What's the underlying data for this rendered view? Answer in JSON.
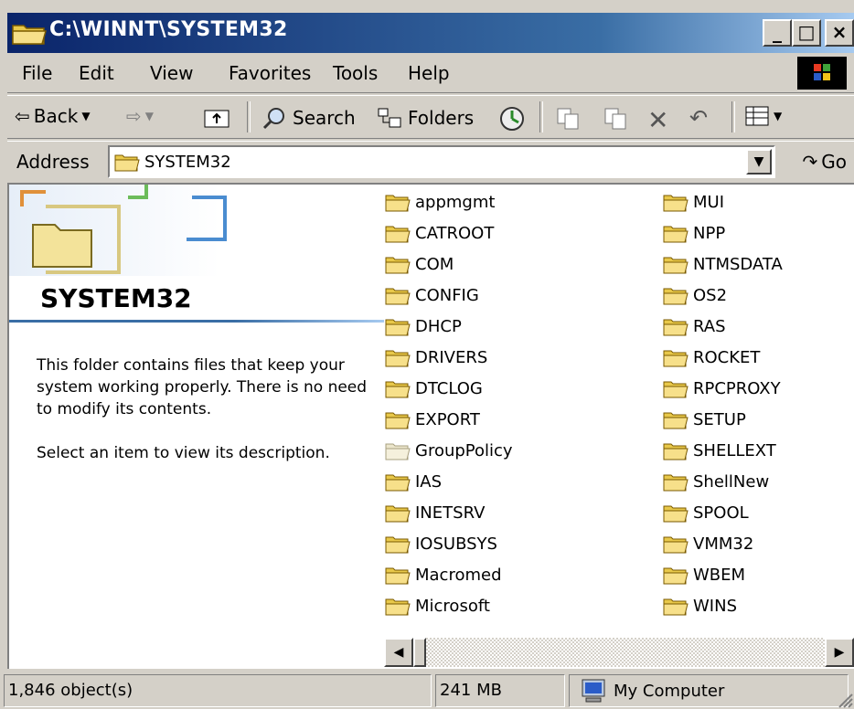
{
  "window": {
    "title": "C:\\WINNT\\SYSTEM32",
    "controls": {
      "minimize": "_",
      "maximize": "□",
      "close": "×"
    }
  },
  "menu": [
    "File",
    "Edit",
    "View",
    "Favorites",
    "Tools",
    "Help"
  ],
  "toolbar": {
    "back_label": "Back",
    "search_label": "Search",
    "folders_label": "Folders"
  },
  "address": {
    "label": "Address",
    "value": "SYSTEM32",
    "go_label": "Go"
  },
  "left_pane": {
    "heading": "SYSTEM32",
    "description": "This folder contains files that keep your system working properly. There is no need to modify its contents.",
    "hint": "Select an item to view its description."
  },
  "folders_col1": [
    "appmgmt",
    "CATROOT",
    "COM",
    "CONFIG",
    "DHCP",
    "DRIVERS",
    "DTCLOG",
    "EXPORT",
    "GroupPolicy",
    "IAS",
    "INETSRV",
    "IOSUBSYS",
    "Macromed",
    "Microsoft"
  ],
  "folders_col2": [
    "MUI",
    "NPP",
    "NTMSDATA",
    "OS2",
    "RAS",
    "ROCKET",
    "RPCPROXY",
    "SETUP",
    "SHELLEXT",
    "ShellNew",
    "SPOOL",
    "VMM32",
    "WBEM",
    "WINS"
  ],
  "status": {
    "objects": "1,846 object(s)",
    "size": "241 MB",
    "zone": "My Computer"
  }
}
